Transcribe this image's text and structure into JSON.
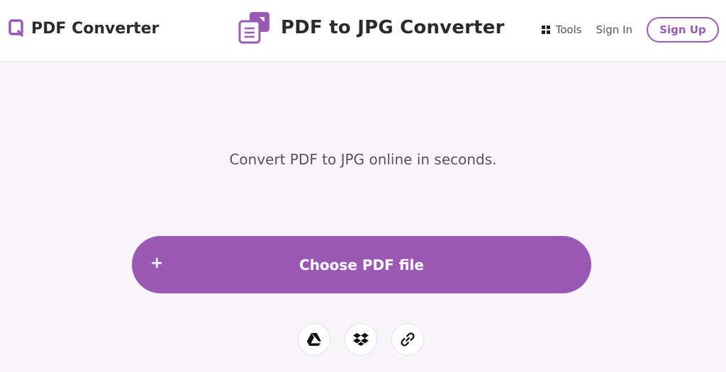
{
  "header": {
    "brand_name": "PDF Converter",
    "page_heading": "PDF to JPG Converter",
    "nav": {
      "tools_label": "Tools",
      "signin_label": "Sign In",
      "signup_label": "Sign Up"
    }
  },
  "main": {
    "subtitle": "Convert PDF to JPG online in seconds.",
    "choose_button": {
      "plus": "+",
      "label": "Choose PDF file"
    },
    "sources": [
      {
        "icon": "google-drive-icon"
      },
      {
        "icon": "dropbox-icon"
      },
      {
        "icon": "link-icon"
      }
    ]
  },
  "colors": {
    "accent": "#9b59b6",
    "background": "#f9f3fb",
    "text": "#2b2b2b"
  }
}
